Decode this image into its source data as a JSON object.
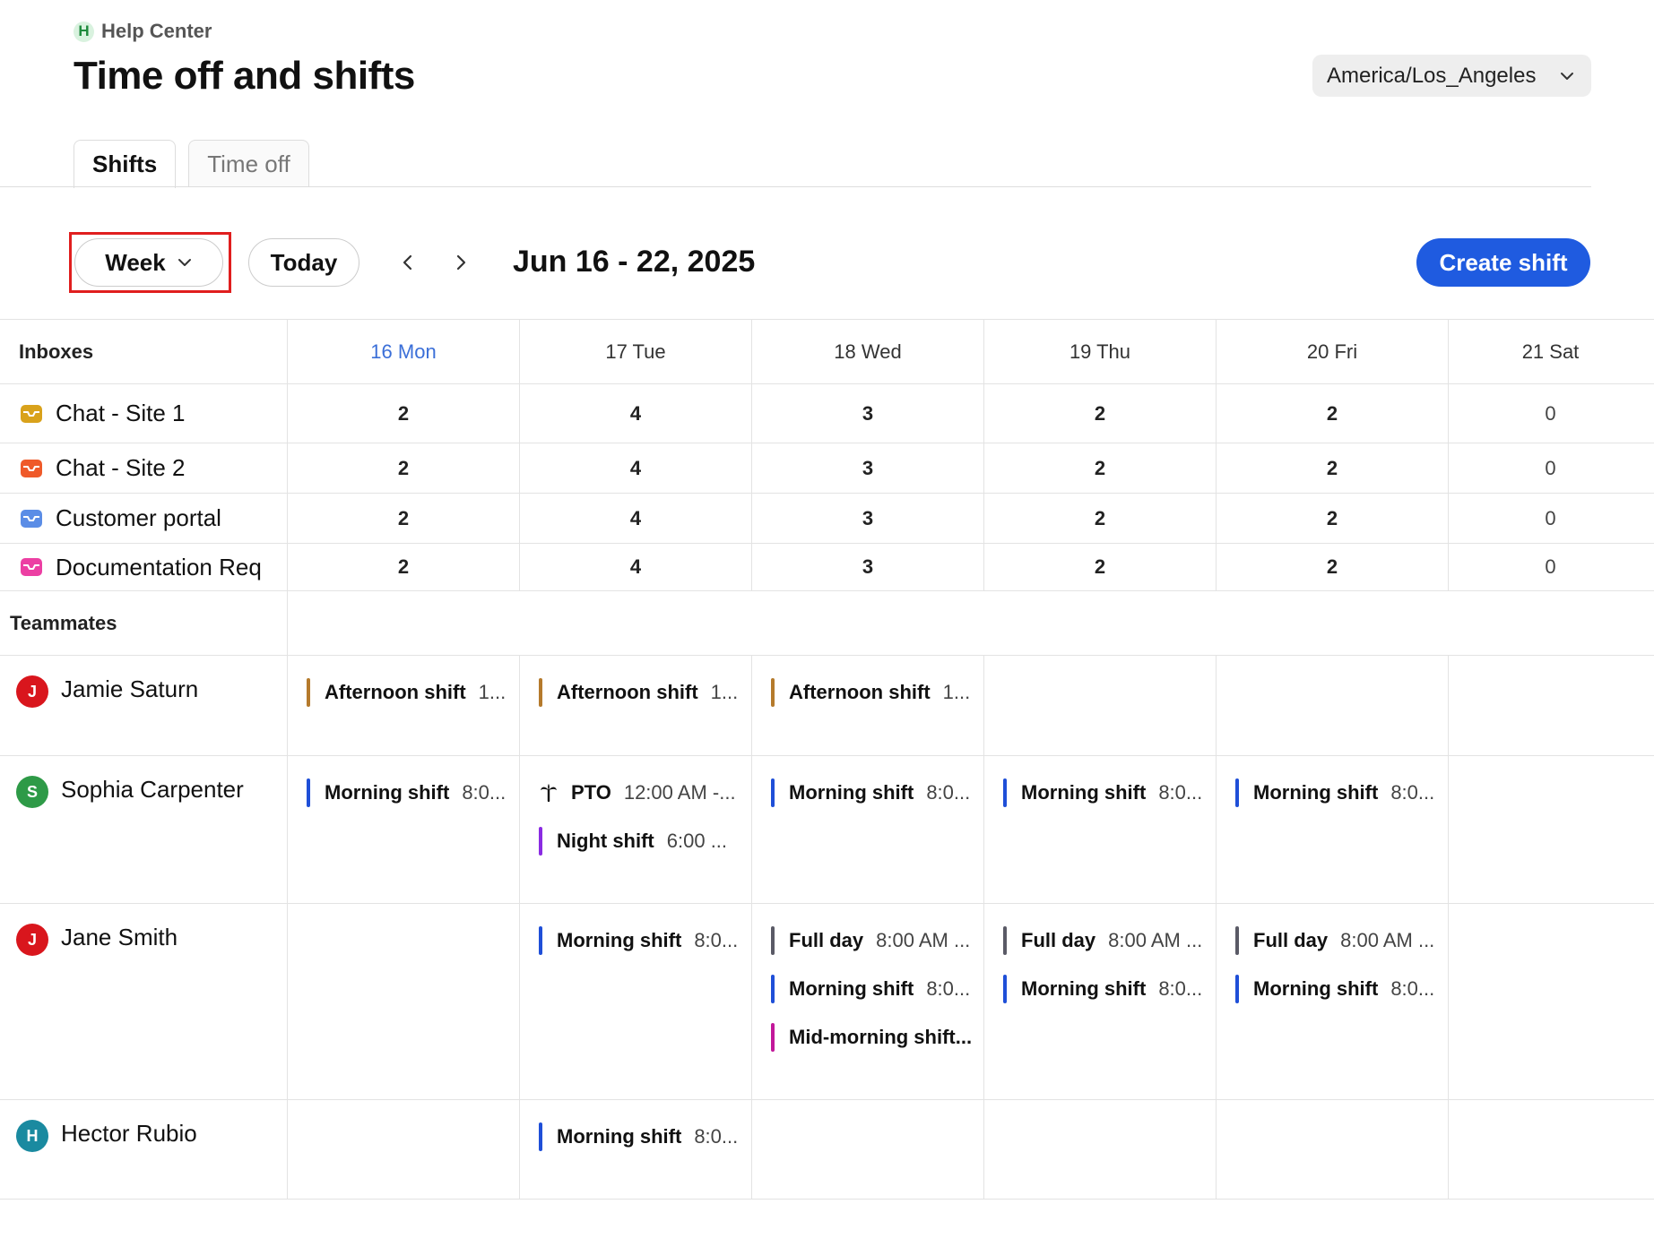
{
  "breadcrumb": {
    "badge": "H",
    "label": "Help Center"
  },
  "page_title": "Time off and shifts",
  "timezone": {
    "value": "America/Los_Angeles",
    "icon": "chevron-down-icon"
  },
  "tabs": [
    {
      "label": "Shifts",
      "active": true
    },
    {
      "label": "Time off",
      "active": false
    }
  ],
  "toolbar": {
    "view": "Week",
    "today": "Today",
    "prev_icon": "chevron-left-icon",
    "next_icon": "chevron-right-icon",
    "date_range": "Jun 16 - 22, 2025",
    "create_button": "Create shift"
  },
  "colors": {
    "accent": "#1f5be0",
    "today_header": "#3b6fd8",
    "highlight": "#e01e1e",
    "afternoon": "#b57a2c",
    "morning": "#1f4fd8",
    "night": "#8a2be2",
    "full_day": "#5a5a66",
    "mid_morning": "#c2189a"
  },
  "schedule": {
    "inboxes_header": "Inboxes",
    "days": [
      "16 Mon",
      "17 Tue",
      "18 Wed",
      "19 Thu",
      "20 Fri",
      "21 Sat"
    ],
    "inboxes": [
      {
        "name": "Chat - Site 1",
        "icon_color": "#d9a21b",
        "counts": [
          "2",
          "4",
          "3",
          "2",
          "2",
          "0"
        ]
      },
      {
        "name": "Chat - Site 2",
        "icon_color": "#ef5a2a",
        "counts": [
          "2",
          "4",
          "3",
          "2",
          "2",
          "0"
        ]
      },
      {
        "name": "Customer portal",
        "icon_color": "#5b8de6",
        "counts": [
          "2",
          "4",
          "3",
          "2",
          "2",
          "0"
        ]
      },
      {
        "name": "Documentation Req",
        "icon_color": "#ec3fa3",
        "counts": [
          "2",
          "4",
          "3",
          "2",
          "2",
          "0"
        ]
      }
    ],
    "teammates_header": "Teammates",
    "teammates": [
      {
        "name": "Jamie Saturn",
        "initial": "J",
        "avatar_color": "#d9161d",
        "shifts": [
          [
            {
              "name": "Afternoon shift",
              "time": "1..."
            }
          ],
          [
            {
              "name": "Afternoon shift",
              "time": "1..."
            }
          ],
          [
            {
              "name": "Afternoon shift",
              "time": "1..."
            }
          ],
          [],
          [],
          []
        ]
      },
      {
        "name": "Sophia Carpenter",
        "initial": "S",
        "avatar_color": "#2e9a47",
        "shifts": [
          [
            {
              "name": "Morning shift",
              "time": "8:0..."
            }
          ],
          [
            {
              "name": "PTO",
              "time": "12:00 AM -...",
              "icon": "palm-tree-icon"
            },
            {
              "name": "Night shift",
              "time": "6:00 ..."
            }
          ],
          [
            {
              "name": "Morning shift",
              "time": "8:0..."
            }
          ],
          [
            {
              "name": "Morning shift",
              "time": "8:0..."
            }
          ],
          [
            {
              "name": "Morning shift",
              "time": "8:0..."
            }
          ],
          []
        ]
      },
      {
        "name": "Jane Smith",
        "initial": "J",
        "avatar_color": "#d9161d",
        "shifts": [
          [],
          [
            {
              "name": "Morning shift",
              "time": "8:0..."
            }
          ],
          [
            {
              "name": "Full day",
              "time": "8:00 AM ..."
            },
            {
              "name": "Morning shift",
              "time": "8:0..."
            },
            {
              "name": "Mid-morning shift...",
              "time": ""
            }
          ],
          [
            {
              "name": "Full day",
              "time": "8:00 AM ..."
            },
            {
              "name": "Morning shift",
              "time": "8:0..."
            }
          ],
          [
            {
              "name": "Full day",
              "time": "8:00 AM ..."
            },
            {
              "name": "Morning shift",
              "time": "8:0..."
            }
          ],
          []
        ]
      },
      {
        "name": "Hector Rubio",
        "initial": "H",
        "avatar_color": "#1a8aa0",
        "shifts": [
          [],
          [
            {
              "name": "Morning shift",
              "time": "8:0..."
            }
          ],
          [],
          [],
          [],
          []
        ]
      }
    ]
  }
}
